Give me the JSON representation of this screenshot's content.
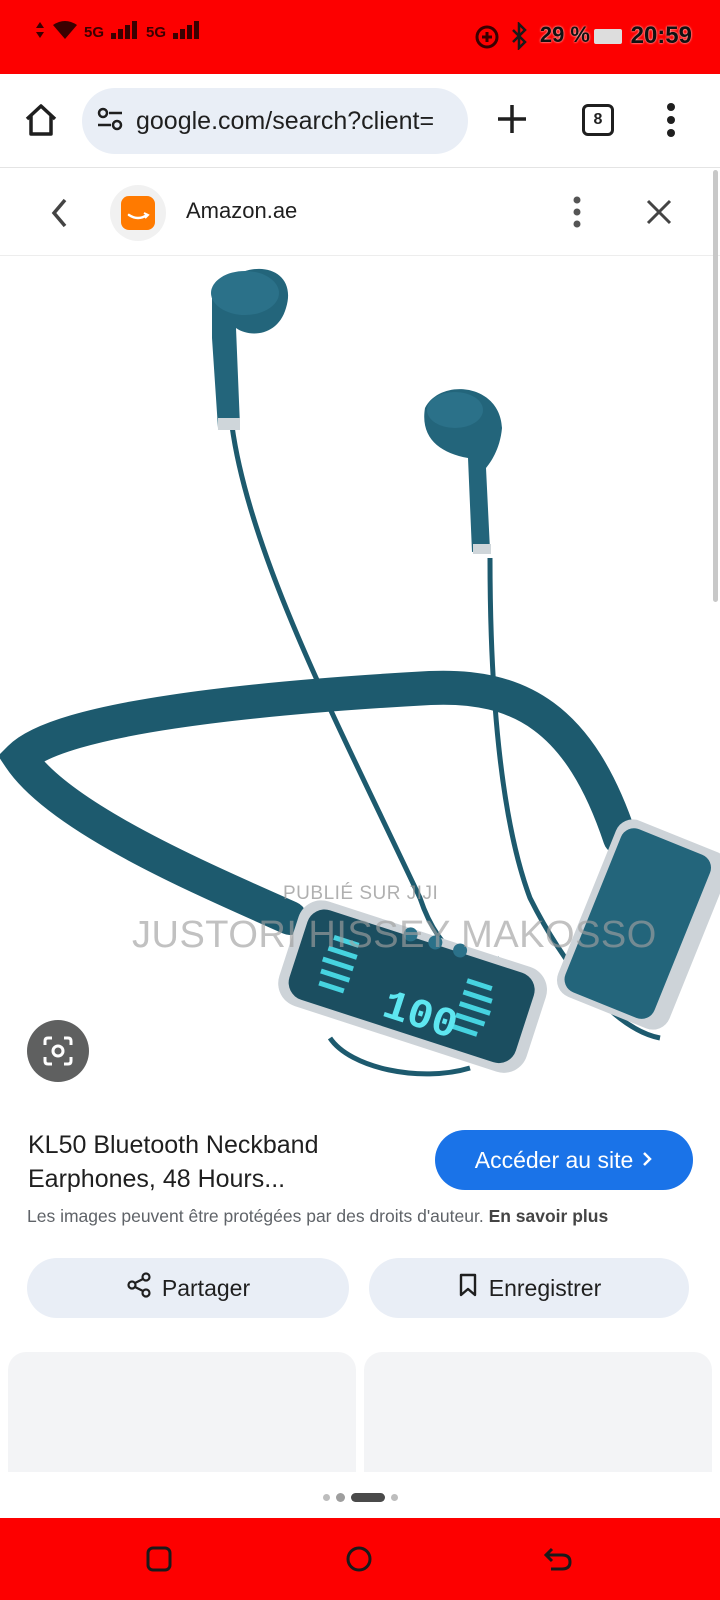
{
  "status_bar": {
    "network1": "5G",
    "network2": "5G",
    "battery": "29 %",
    "time": "20:59"
  },
  "browser": {
    "url": "google.com/search?client=",
    "tab_count": "8"
  },
  "source": {
    "name": "Amazon.ae"
  },
  "image": {
    "watermark_small": "PUBLIÉ SUR JIJI",
    "watermark_large": "JUSTORI HISSEY MAKOSSO",
    "display_number": "100"
  },
  "result": {
    "title": "KL50 Bluetooth Neckband Earphones, 48 Hours...",
    "visit_label": "Accéder au site",
    "copyright_text": "Les images peuvent être protégées par des droits d'auteur.",
    "learn_more": "En savoir plus",
    "share_label": "Partager",
    "save_label": "Enregistrer"
  },
  "colors": {
    "status_bar": "#fd0000",
    "nav_bar": "#fd0000",
    "accent": "#1a73e8",
    "product": "#1d5a6e"
  }
}
